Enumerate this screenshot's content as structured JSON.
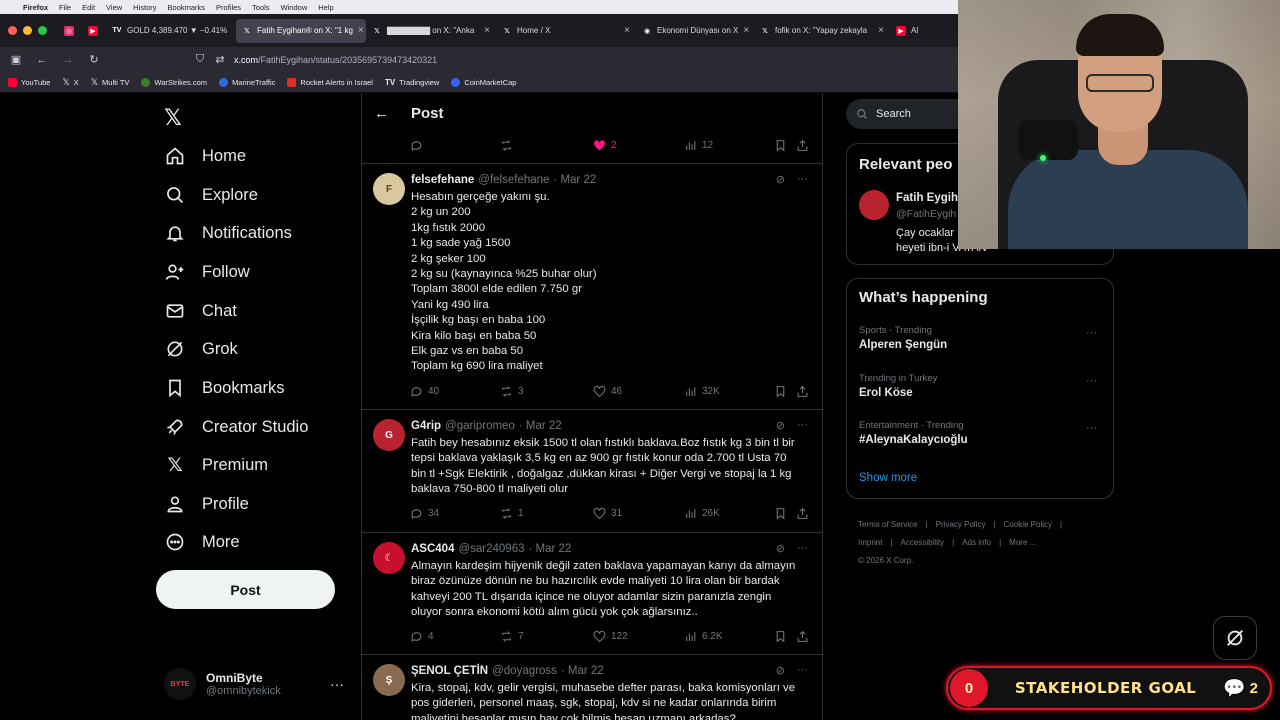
{
  "menubar": {
    "items": [
      "Firefox",
      "File",
      "Edit",
      "View",
      "History",
      "Bookmarks",
      "Profiles",
      "Tools",
      "Window",
      "Help"
    ]
  },
  "tabs": [
    {
      "label": "",
      "icon": "instagram-icon",
      "color": "#e1306c"
    },
    {
      "label": "",
      "icon": "youtube-icon",
      "color": "#ff0033"
    },
    {
      "label": "GOLD 4,389.470 ▼ −0.41%",
      "icon": "tradingview-icon",
      "color": "#ffffff"
    },
    {
      "label": "Fatih Eygihan® on X: \"1 kg",
      "icon": "x-icon",
      "color": "#ffffff",
      "active": true
    },
    {
      "label": "▇▇▇▇▇▇▇ on X: \"Anka",
      "icon": "x-icon",
      "color": "#ffffff"
    },
    {
      "label": "Home / X",
      "icon": "x-icon",
      "color": "#ffffff"
    },
    {
      "label": "Ekonomi Dünyası on X",
      "icon": "globe-icon",
      "color": "#ffffff"
    },
    {
      "label": "fofik on X: \"Yapay zekayla",
      "icon": "x-icon",
      "color": "#ffffff"
    },
    {
      "label": "Al",
      "icon": "youtube-icon",
      "color": "#ff0033"
    }
  ],
  "navbar": {
    "url_host": "x.com",
    "url_path": "/FatihEygihan/status/2035695739473420321"
  },
  "bookmarks": [
    {
      "label": "YouTube",
      "color": "#ff0033"
    },
    {
      "label": "X",
      "color": "#ffffff"
    },
    {
      "label": "Multi TV",
      "color": "#ffffff"
    },
    {
      "label": "WarStrikes.com",
      "color": "#3a7d2c"
    },
    {
      "label": "MarineTraffic",
      "color": "#2d6cdf"
    },
    {
      "label": "Rocket Alerts in Israel",
      "color": "#d93025"
    },
    {
      "label": "Tradingview",
      "color": "#ffffff"
    },
    {
      "label": "CoinMarketCap",
      "color": "#3861fb"
    }
  ],
  "leftnav": {
    "items": [
      {
        "label": "Home",
        "icon": "home-icon"
      },
      {
        "label": "Explore",
        "icon": "search-icon"
      },
      {
        "label": "Notifications",
        "icon": "bell-icon"
      },
      {
        "label": "Follow",
        "icon": "follow-icon"
      },
      {
        "label": "Chat",
        "icon": "mail-icon"
      },
      {
        "label": "Grok",
        "icon": "grok-icon"
      },
      {
        "label": "Bookmarks",
        "icon": "bookmark-icon"
      },
      {
        "label": "Creator Studio",
        "icon": "rocket-icon"
      },
      {
        "label": "Premium",
        "icon": "x-icon"
      },
      {
        "label": "Profile",
        "icon": "person-icon"
      },
      {
        "label": "More",
        "icon": "more-icon"
      }
    ],
    "post_label": "Post",
    "account": {
      "name": "OmniByte",
      "handle": "@omnibytekick",
      "avatar_text": "BYTE"
    }
  },
  "main": {
    "title": "Post",
    "top_actions": {
      "replies": "",
      "reposts": "",
      "likes": "2",
      "views": "12"
    },
    "tweets": [
      {
        "name": "felsefehane",
        "handle": "@felsefehane",
        "date": "· Mar 22",
        "avatar_text": "F",
        "avatar_color": "#d9c7a0",
        "lines": [
          "Hesabın gerçeğe yakını şu.",
          "2 kg un 200",
          "1kg fıstık 2000",
          "1 kg sade yağ 1500",
          "2 kg şeker 100",
          "2 kg su (kaynayınca %25 buhar olur)",
          "Toplam 3800l elde edilen 7.750 gr",
          "Yani kg 490 lira",
          "İşçilik kg başı en baba 100",
          "Kira kilo başı en baba 50",
          "Elk gaz vs en baba 50",
          "Toplam kg 690 lira maliyet"
        ],
        "replies": "40",
        "reposts": "3",
        "likes": "46",
        "views": "32K"
      },
      {
        "name": "G4rip",
        "handle": "@garipromeo",
        "date": "· Mar 22",
        "avatar_text": "G",
        "avatar_color": "#b8232f",
        "lines": [
          "Fatih bey hesabınız eksik 1500 tl olan fıstıklı baklava.Boz fıstık kg 3 bin tl bir",
          "tepsi baklava yaklaşık 3,5 kg en az 900 gr fıstık konur oda 2.700 tl Usta 70",
          "bin tl +Sgk Elektirik , doğalgaz ,dükkan kirası + Diğer Vergi ve stopaj la 1 kg",
          "baklava 750-800 tl  maliyeti olur"
        ],
        "replies": "34",
        "reposts": "1",
        "likes": "31",
        "views": "26K"
      },
      {
        "name": "ASC404",
        "handle": "@sar240963",
        "date": "· Mar 22",
        "avatar_text": "☾",
        "avatar_color": "#c8102e",
        "lines": [
          "Almayın kardeşim hijyenik değil zaten baklava yapamayan karıyı da almayın",
          "biraz özünüze dönün ne bu hazırcılık evde maliyeti 10 lira olan bir bardak",
          "kahveyi 200 TL dışarıda içince ne oluyor adamlar sizin paranızla zengin",
          "oluyor  sonra ekonomi kötü alım gücü yok çok ağlarsınız.."
        ],
        "replies": "4",
        "reposts": "7",
        "likes": "122",
        "views": "6.2K"
      },
      {
        "name": "ŞENOL ÇETİN",
        "handle": "@doyagross",
        "date": "· Mar 22",
        "avatar_text": "Ş",
        "avatar_color": "#8a6b4f",
        "lines": [
          "Kira, stopaj, kdv, gelir vergisi, muhasebe defter parası, baka komisyonları ve",
          "pos giderleri, personel maaş, sgk, stopaj, kdv si ne kadar onlarında birim",
          "maliyetini hesaplar mısın bay çok bilmiş hesap uzmanı arkadaş?"
        ],
        "replies": "",
        "reposts": "",
        "likes": "",
        "views": ""
      }
    ]
  },
  "right": {
    "search_placeholder": "Search",
    "relevant": {
      "title": "Relevant peo",
      "name": "Fatih Eygiha",
      "handle": "@FatihEygih",
      "bio_1": "Çay ocaklar",
      "bio_2": "heyeti ibn-i VATAN"
    },
    "happening": {
      "title": "What’s happening",
      "trends": [
        {
          "context": "Sports · Trending",
          "title": "Alperen Şengün"
        },
        {
          "context": "Trending in Turkey",
          "title": "Erol Köse"
        },
        {
          "context": "Entertainment · Trending",
          "title": "#AleynaKalaycıoğlu"
        }
      ],
      "show_more": "Show more"
    },
    "footer": {
      "links_1": [
        "Terms of Service",
        "|",
        "Privacy Policy",
        "|",
        "Cookie Policy",
        "|"
      ],
      "links_2": [
        "Imprint",
        "|",
        "Accessibility",
        "|",
        "Ads info",
        "|",
        "More ..."
      ],
      "copyright": "© 2026 X Corp."
    }
  },
  "overlay": {
    "goal_count": "0",
    "goal_label": "STAKEHOLDER GOAL",
    "goal_right": "2"
  },
  "colors": {
    "like_pink": "#f91880",
    "link_blue": "#1d9bf0",
    "goal_red": "#e0162b"
  }
}
